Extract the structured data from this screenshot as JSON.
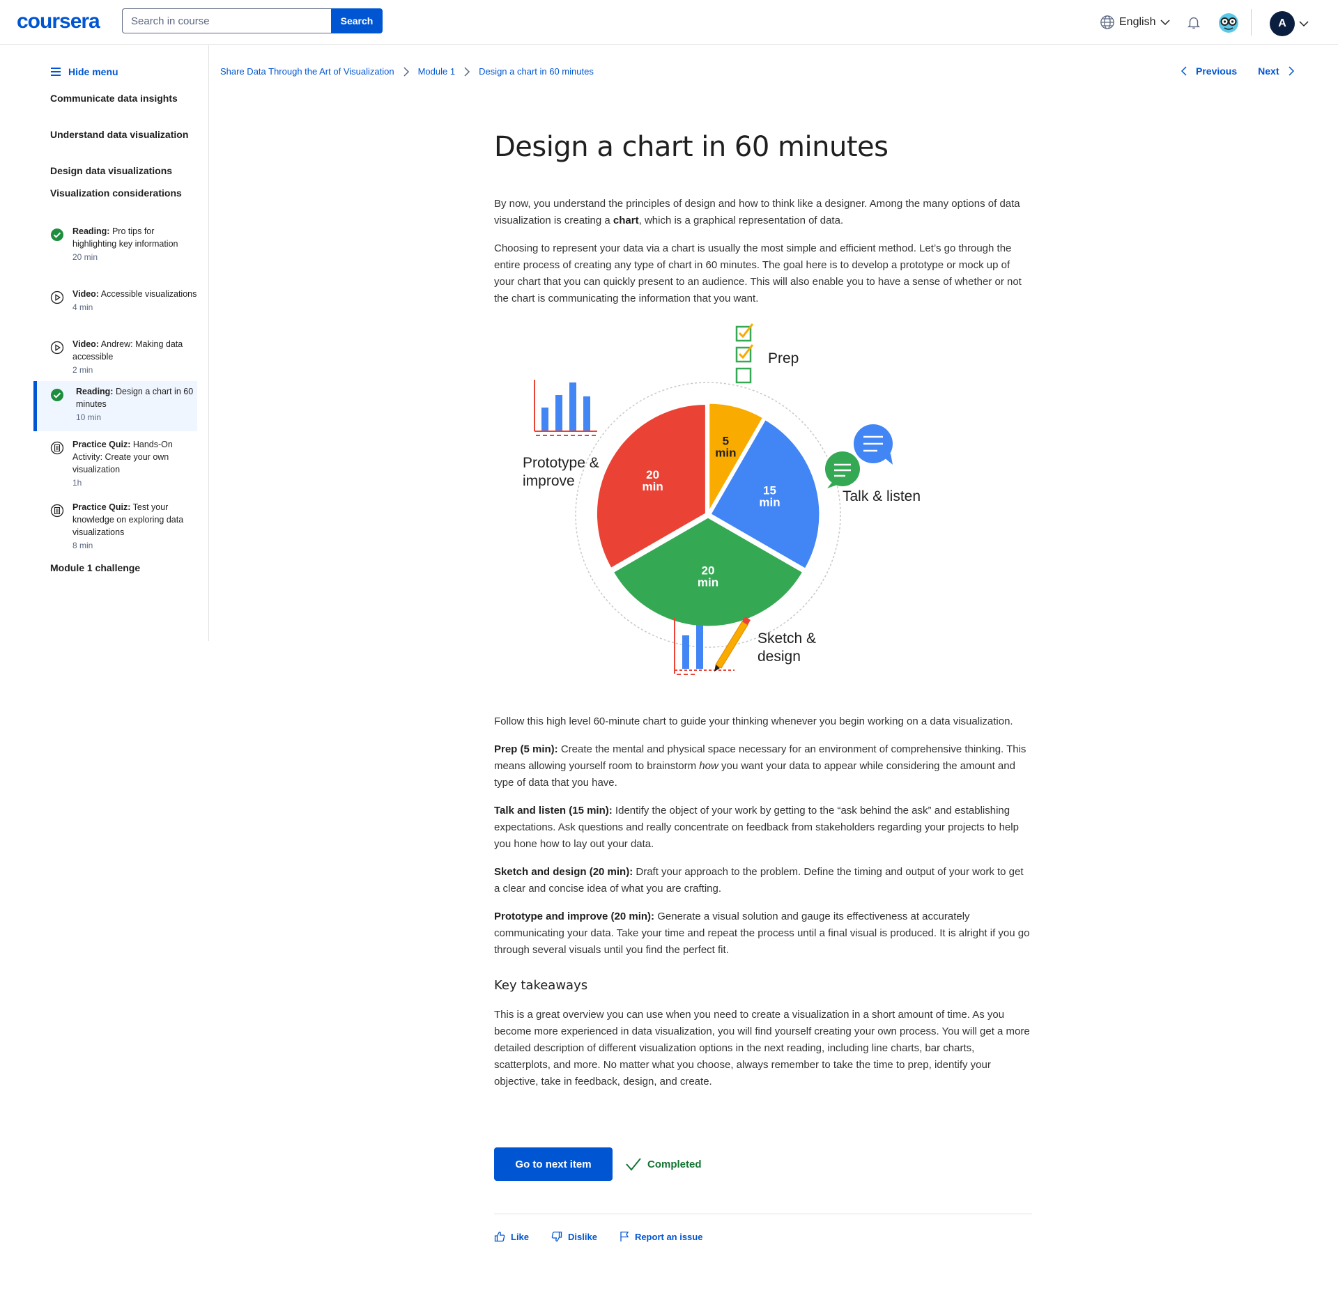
{
  "header": {
    "logo": "coursera",
    "search_placeholder": "Search in course",
    "search_button": "Search",
    "language": "English",
    "avatar_initial": "A"
  },
  "sidebar": {
    "hide_menu": "Hide menu",
    "sections": [
      "Communicate data insights",
      "Understand data visualization",
      "Design data visualizations",
      "Visualization considerations",
      "Module 1 challenge"
    ],
    "items": [
      {
        "type": "Reading:",
        "title": "Pro tips for highlighting key information",
        "duration": "20 min",
        "status": "completed"
      },
      {
        "type": "Video:",
        "title": "Accessible visualizations",
        "duration": "4 min",
        "status": "video"
      },
      {
        "type": "Video:",
        "title": "Andrew: Making data accessible",
        "duration": "2 min",
        "status": "video"
      },
      {
        "type": "Reading:",
        "title": "Design a chart in 60 minutes",
        "duration": "10 min",
        "status": "completed-active"
      },
      {
        "type": "Practice Quiz:",
        "title": "Hands-On Activity: Create your own visualization",
        "duration": "1h",
        "status": "quiz"
      },
      {
        "type": "Practice Quiz:",
        "title": "Test your knowledge on exploring data visualizations",
        "duration": "8 min",
        "status": "quiz"
      }
    ]
  },
  "breadcrumb": [
    "Share Data Through the Art of Visualization",
    "Module 1",
    "Design a chart in 60 minutes"
  ],
  "nav": {
    "previous": "Previous",
    "next": "Next"
  },
  "article": {
    "title": "Design a chart in 60 minutes",
    "p1_a": "By now, you understand the principles of design and how to think like a designer. Among the many options of data visualization is creating a ",
    "p1_bold": "chart",
    "p1_b": ", which is a graphical representation of data.",
    "p2": "Choosing to represent your data via a chart is usually the most simple and efficient method. Let’s go through the entire process of creating any type of chart in 60 minutes. The goal here is to develop a prototype or mock up of your chart that you can quickly present to an audience. This will also enable you to have a sense of whether or not the chart is communicating the information that you want.",
    "p3": "Follow this high level 60-minute chart to guide your thinking whenever you begin working on a data visualization.",
    "prep_label": "Prep (5 min):",
    "prep_a": " Create the mental and physical space necessary for an environment of comprehensive thinking. This means allowing yourself room to brainstorm ",
    "prep_em": "how",
    "prep_b": " you want your data to appear while considering the amount and type of data that you have.",
    "talk_label": "Talk and listen (15 min):",
    "talk_text": " Identify the object of your work by getting to the “ask behind the ask” and establishing expectations. Ask questions and really concentrate on feedback from stakeholders regarding your projects to help you hone how to lay out your data.",
    "sketch_label": "Sketch and design (20 min):",
    "sketch_text": " Draft your approach to the problem. Define the timing and output of your work to get a clear and concise idea of what you are crafting.",
    "proto_label": "Prototype and improve (20 min):",
    "proto_text": " Generate a visual solution and gauge its effectiveness at accurately communicating your data. Take your time and repeat the process until a final visual is produced. It is alright if you go through several visuals until you find the perfect fit.",
    "takeaways_title": "Key takeaways",
    "takeaways_text": "This is a great overview you can use when you need to create a visualization in a short amount of time. As you become more experienced in data visualization, you will find yourself creating your own process. You will get a more detailed description of different visualization options in the next reading, including line charts, bar charts, scatterplots, and more. No matter what you choose, always remember to take the time to prep, identify your objective, take in feedback, design, and create."
  },
  "chart_data": {
    "type": "pie",
    "categories": [
      "Prep",
      "Talk & listen",
      "Sketch & design",
      "Prototype & improve"
    ],
    "values": [
      5,
      15,
      20,
      20
    ],
    "slice_labels": [
      "5 min",
      "15 min",
      "20 min",
      "20 min"
    ],
    "label_lines": [
      [
        "Prep"
      ],
      [
        "Talk & listen"
      ],
      [
        "Sketch &",
        "design"
      ],
      [
        "Prototype &",
        "improve"
      ]
    ],
    "colors": [
      "#F9AB00",
      "#4285F4",
      "#34A853",
      "#EA4335"
    ]
  },
  "actions": {
    "next_item": "Go to next item",
    "completed": "Completed",
    "like": "Like",
    "dislike": "Dislike",
    "report": "Report an issue"
  }
}
